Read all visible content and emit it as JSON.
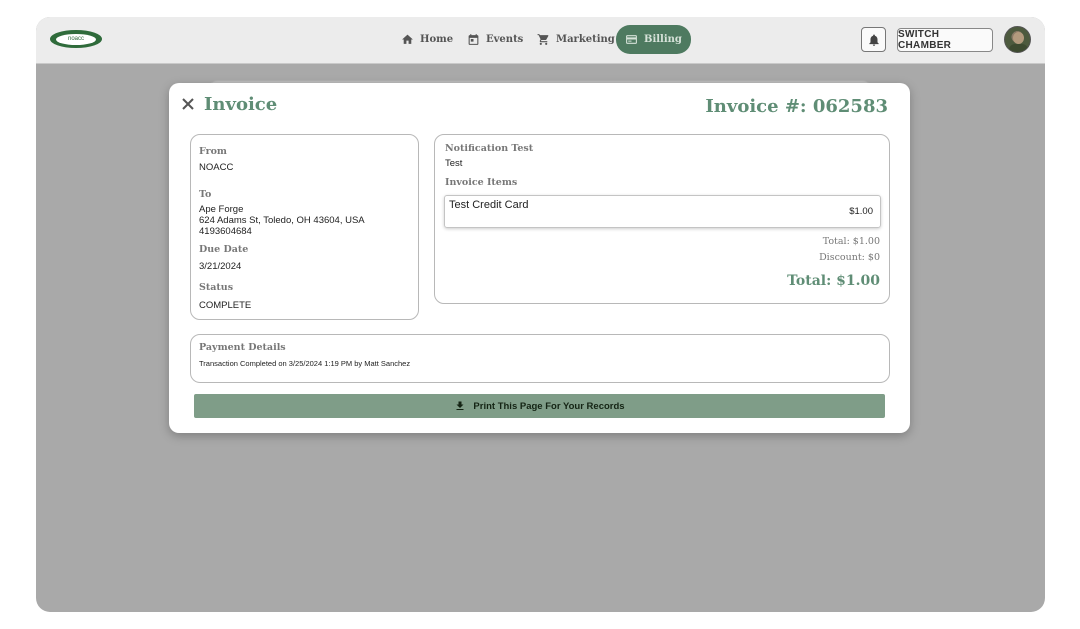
{
  "topbar": {
    "logo_text": "noacc",
    "nav": [
      {
        "label": "Home",
        "icon": "home-icon"
      },
      {
        "label": "Events",
        "icon": "calendar-icon"
      },
      {
        "label": "Marketing",
        "icon": "cart-icon"
      },
      {
        "label": "Billing",
        "icon": "billing-icon",
        "active": true
      }
    ],
    "switch_label": "SWITCH CHAMBER"
  },
  "modal": {
    "title": "Invoice",
    "invoice_number": "Invoice #: 062583",
    "from_label": "From",
    "from_value": "NOACC",
    "to_label": "To",
    "to_name": "Ape Forge",
    "to_address": "624 Adams St, Toledo, OH 43604, USA",
    "to_phone": "4193604684",
    "due_label": "Due Date",
    "due_value": "3/21/2024",
    "status_label": "Status",
    "status_value": "COMPLETE",
    "notification_label": "Notification Test",
    "notification_value": "Test",
    "items_label": "Invoice Items",
    "items": [
      {
        "name": "Test Credit Card",
        "price": "$1.00"
      }
    ],
    "subtotal": "Total: $1.00",
    "discount": "Discount: $0",
    "total": "Total: $1.00",
    "payment_label": "Payment Details",
    "payment_value": "Transaction Completed on 3/25/2024 1:19 PM by Matt Sanchez",
    "print_label": "Print This Page For Your Records"
  },
  "colors": {
    "accent": "#5f8d75",
    "nav_active": "#4e7a60",
    "print_button": "#7f9d88",
    "backdrop": "#a9a9a9"
  }
}
